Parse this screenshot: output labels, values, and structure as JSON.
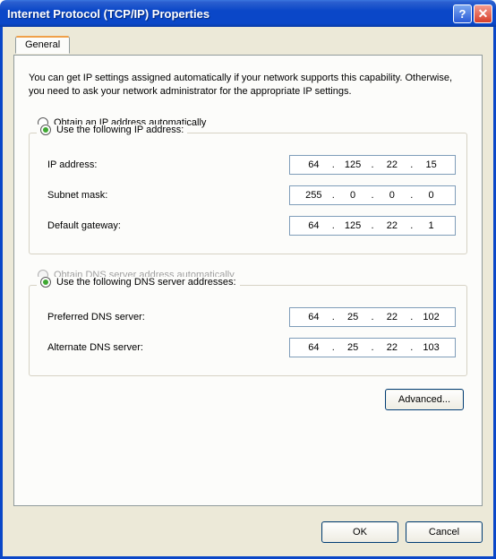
{
  "window": {
    "title": "Internet Protocol (TCP/IP) Properties",
    "help_symbol": "?",
    "close_symbol": "✕"
  },
  "tab": {
    "label": "General"
  },
  "intro_text": "You can get IP settings assigned automatically if your network supports this capability. Otherwise, you need to ask your network administrator for the appropriate IP settings.",
  "ip_section": {
    "option_auto": "Obtain an IP address automatically",
    "option_manual": "Use the following IP address:",
    "fields": {
      "ip_label": "IP address:",
      "ip_value": {
        "o1": "64",
        "o2": "125",
        "o3": "22",
        "o4": "15"
      },
      "subnet_label": "Subnet mask:",
      "subnet_value": {
        "o1": "255",
        "o2": "0",
        "o3": "0",
        "o4": "0"
      },
      "gateway_label": "Default gateway:",
      "gateway_value": {
        "o1": "64",
        "o2": "125",
        "o3": "22",
        "o4": "1"
      }
    }
  },
  "dns_section": {
    "option_auto": "Obtain DNS server address automatically",
    "option_manual": "Use the following DNS server addresses:",
    "fields": {
      "preferred_label": "Preferred DNS server:",
      "preferred_value": {
        "o1": "64",
        "o2": "25",
        "o3": "22",
        "o4": "102"
      },
      "alternate_label": "Alternate DNS server:",
      "alternate_value": {
        "o1": "64",
        "o2": "25",
        "o3": "22",
        "o4": "103"
      }
    }
  },
  "buttons": {
    "advanced": "Advanced...",
    "ok": "OK",
    "cancel": "Cancel"
  }
}
